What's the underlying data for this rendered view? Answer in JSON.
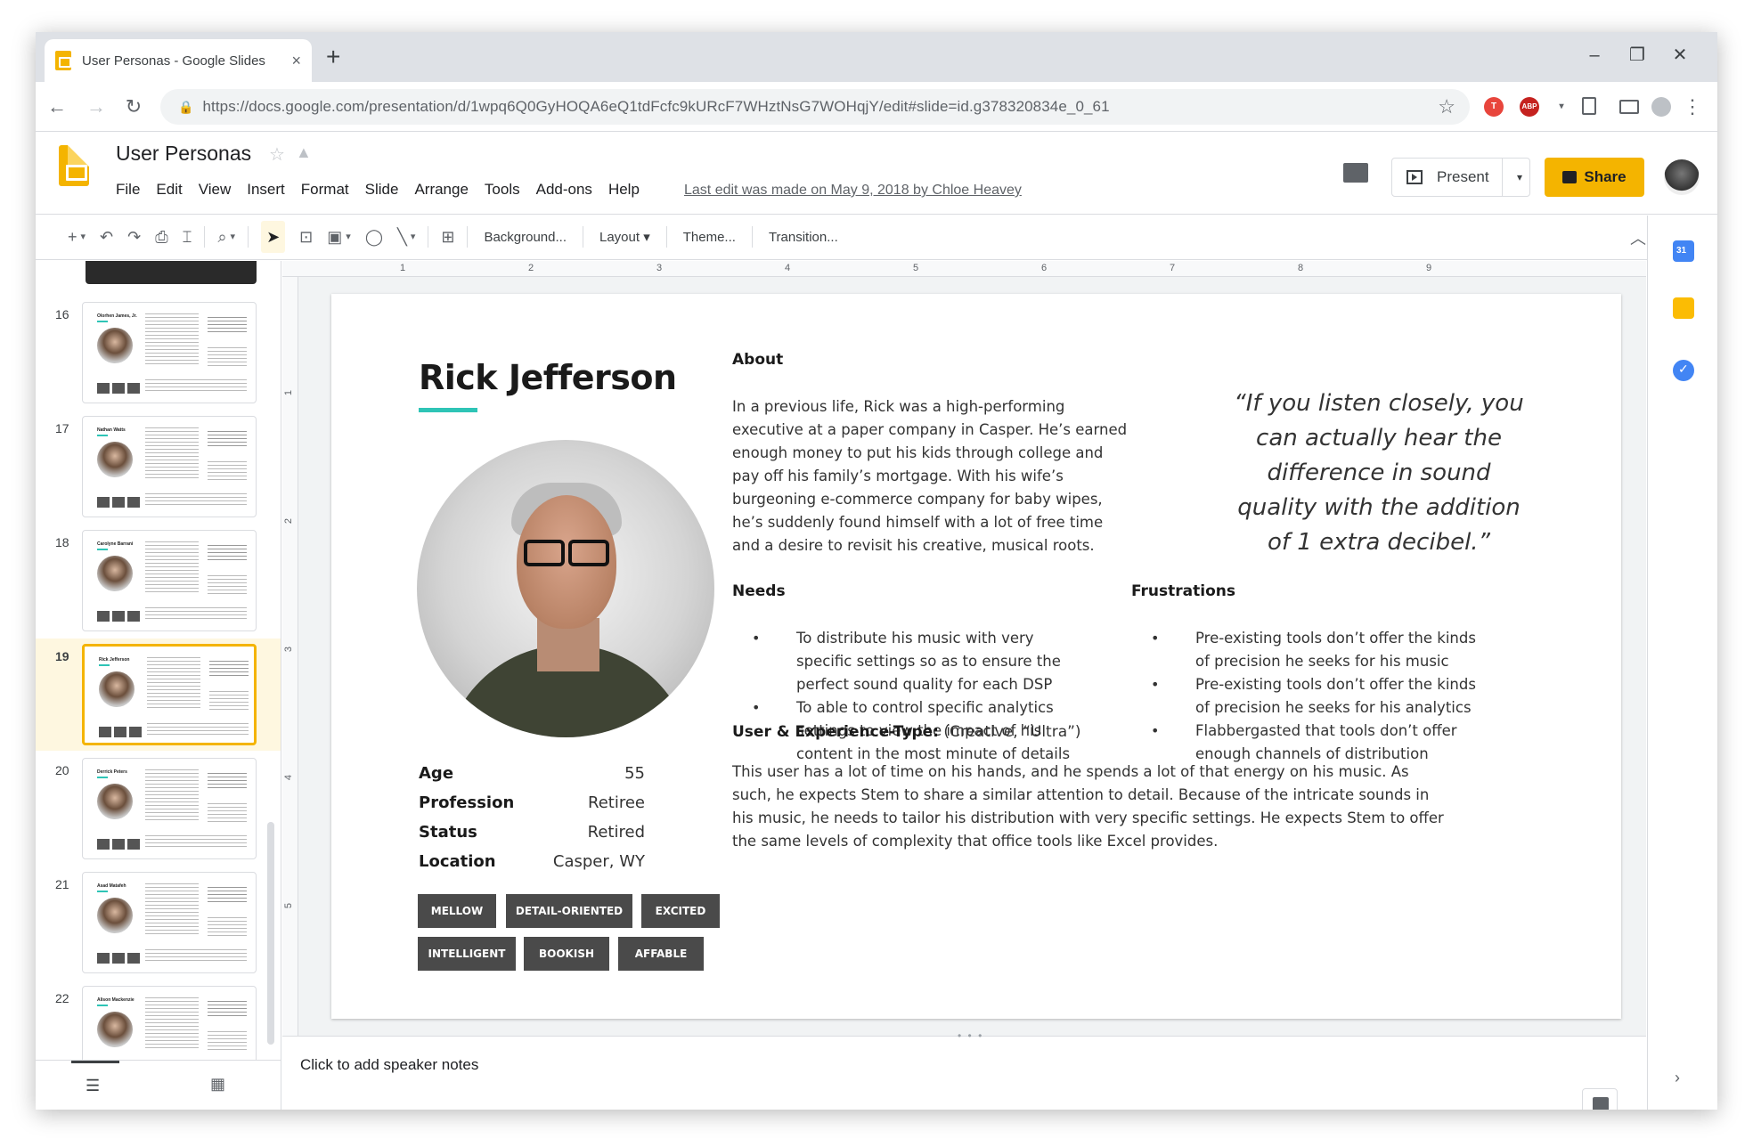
{
  "browser": {
    "tab_title": "User Personas - Google Slides",
    "tab_close": "×",
    "new_tab": "+",
    "url": "https://docs.google.com/presentation/d/1wpq6Q0GyHOQA6eQ1tdFcfc9kURcF7WHztNsG7WOHqjY/edit#slide=id.g378320834e_0_61",
    "minimize": "–",
    "restore": "❐",
    "close": "✕",
    "back": "←",
    "forward": "→",
    "reload": "↻",
    "star": "☆",
    "ext_abp": "ABP",
    "menu": "⋮"
  },
  "doc": {
    "title": "User Personas",
    "menus": [
      "File",
      "Edit",
      "View",
      "Insert",
      "Format",
      "Slide",
      "Arrange",
      "Tools",
      "Add-ons",
      "Help"
    ],
    "last_edit": "Last edit was made on May 9, 2018 by Chloe Heavey",
    "present_label": "Present",
    "share_label": "Share"
  },
  "toolbar": {
    "background": "Background...",
    "layout": "Layout",
    "theme": "Theme...",
    "transition": "Transition..."
  },
  "filmstrip": {
    "slides": [
      {
        "num": "16",
        "name": "Olorhen James, Jr."
      },
      {
        "num": "17",
        "name": "Nathan Watts"
      },
      {
        "num": "18",
        "name": "Carolyne Barrani"
      },
      {
        "num": "19",
        "name": "Rick Jefferson"
      },
      {
        "num": "20",
        "name": "Derrick Peters"
      },
      {
        "num": "21",
        "name": "Asad Matafeh"
      },
      {
        "num": "22",
        "name": "Alison Mackenzie"
      }
    ],
    "selected": "19"
  },
  "ruler": {
    "h": [
      "1",
      "2",
      "3",
      "4",
      "5",
      "6",
      "7",
      "8",
      "9"
    ],
    "v": [
      "1",
      "2",
      "3",
      "4",
      "5"
    ]
  },
  "slide": {
    "name": "Rick Jefferson",
    "attributes": [
      {
        "label": "Age",
        "value": "55"
      },
      {
        "label": "Profession",
        "value": "Retiree"
      },
      {
        "label": "Status",
        "value": "Retired"
      },
      {
        "label": "Location",
        "value": "Casper, WY"
      }
    ],
    "tags_row1": [
      "MELLOW",
      "DETAIL-ORIENTED",
      "EXCITED"
    ],
    "tags_row2": [
      "INTELLIGENT",
      "BOOKISH",
      "AFFABLE"
    ],
    "about_heading": "About",
    "about_text": "In a previous life, Rick was a high-performing executive at a paper company in Casper. He’s earned enough money to put his kids through college and pay off his family’s mortgage. With his wife’s burgeoning e-commerce company for baby wipes, he’s suddenly found himself with a lot of free time and a desire to revisit his creative, musical roots.",
    "quote": "“If you listen closely, you can actually hear the difference in sound quality with the addition of 1 extra decibel.”",
    "needs_heading": "Needs",
    "needs": [
      "To distribute his music with very specific settings so as to ensure the perfect sound quality for each DSP",
      "To able to control specific analytics settings to view the impact of his content in the most minute of details"
    ],
    "frustrations_heading": "Frustrations",
    "frustrations": [
      "Pre-existing tools don’t offer the kinds of precision he seeks for his music",
      "Pre-existing tools don’t offer the kinds of precision he seeks for his analytics",
      "Flabbergasted that tools don’t offer enough channels of distribution"
    ],
    "ux_label": "User & Experience-Type:",
    "ux_value": " (Creative, “Ultra”)",
    "ux_text": "This user has a lot of time on his hands, and he spends a lot of that energy on his music. As such, he expects Stem to share a similar attention to detail. Because of the intricate sounds in his music, he needs to tailor his distribution with very specific settings. He expects Stem to offer the same levels of complexity that office tools like Excel provides."
  },
  "notes": {
    "placeholder": "Click to add speaker notes"
  },
  "colors": {
    "accent": "#f4b400",
    "teal": "#2ec4b6",
    "tag_bg": "#4a4a4a"
  }
}
